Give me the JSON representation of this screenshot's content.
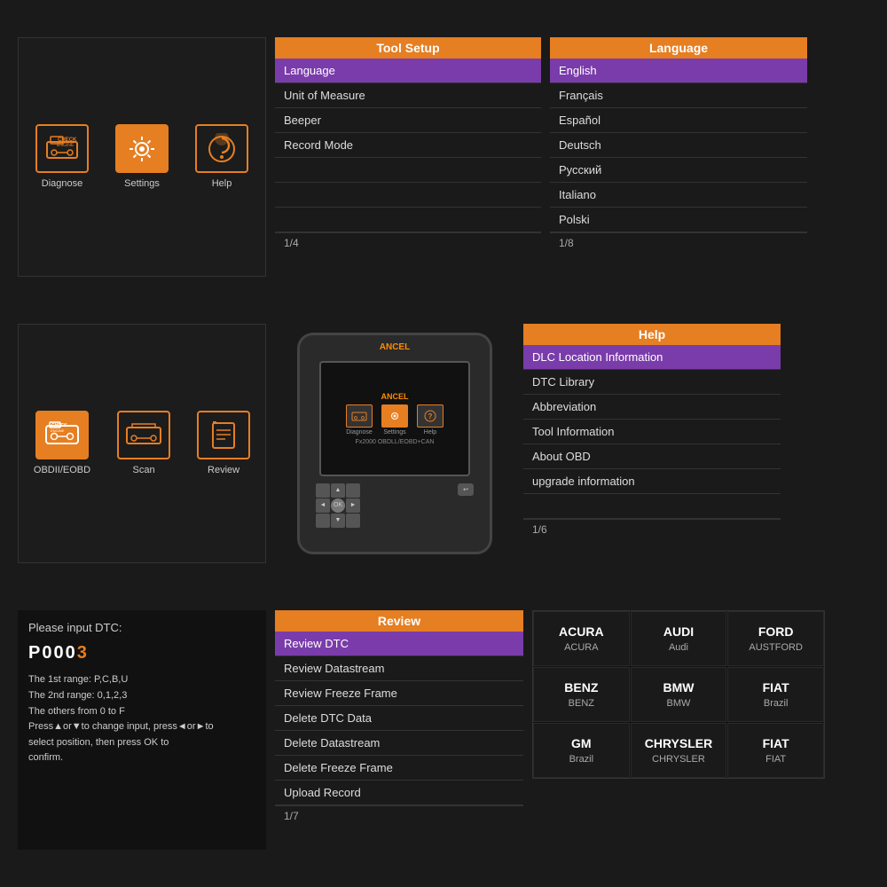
{
  "row1": {
    "main_menu": {
      "items": [
        {
          "id": "diagnose",
          "label": "Diagnose",
          "active": false
        },
        {
          "id": "settings",
          "label": "Settings",
          "active": true
        },
        {
          "id": "help",
          "label": "Help",
          "active": false
        }
      ]
    },
    "tool_setup": {
      "header": "Tool Setup",
      "items": [
        "Language",
        "Unit of Measure",
        "Beeper",
        "Record Mode"
      ],
      "active_index": 0,
      "empty_rows": 3,
      "footer": "1/4"
    },
    "language": {
      "header": "Language",
      "items": [
        "English",
        "Français",
        "Español",
        "Deutsch",
        "Русский",
        "Italiano",
        "Polski"
      ],
      "active_index": 0,
      "footer": "1/8"
    }
  },
  "row2": {
    "diagnose_menu": {
      "items": [
        {
          "id": "obdii",
          "label": "OBDII/EOBD",
          "active": true
        },
        {
          "id": "scan",
          "label": "Scan",
          "active": false
        },
        {
          "id": "review",
          "label": "Review",
          "active": false
        }
      ]
    },
    "device": {
      "brand": "ANCEL",
      "model": "Fx2000 OBDLL/EOBD+CAN",
      "screen_title": "ANCEL",
      "icons": [
        "Diagnose",
        "Settings",
        "Help"
      ]
    },
    "help": {
      "header": "Help",
      "items": [
        "DLC Location Information",
        "DTC Library",
        "Abbreviation",
        "Tool Information",
        "About OBD",
        "upgrade information"
      ],
      "active_index": 0,
      "footer": "1/6"
    }
  },
  "row3": {
    "dtc_input": {
      "title": "Please input DTC:",
      "code_prefix": "P000",
      "code_highlight": "3",
      "description": "The 1st range: P,C,B,U\nThe 2nd range: 0,1,2,3\nThe others from 0 to F\nPress▲or▼to change input, press◄or►to\nselect position, then press OK to\nconfirm."
    },
    "review": {
      "header": "Review",
      "items": [
        "Review DTC",
        "Review Datastream",
        "Review Freeze Frame",
        "Delete DTC Data",
        "Delete Datastream",
        "Delete Freeze Frame",
        "Upload Record"
      ],
      "active_index": 0,
      "footer": "1/7"
    },
    "brands": [
      {
        "large": "ACURA",
        "small": "ACURA"
      },
      {
        "large": "AUDI",
        "small": "Audi"
      },
      {
        "large": "FORD",
        "small": "AUSTFORD"
      },
      {
        "large": "BENZ",
        "small": "BENZ"
      },
      {
        "large": "BMW",
        "small": "BMW"
      },
      {
        "large": "FIAT",
        "small": "Brazil"
      },
      {
        "large": "GM",
        "small": "Brazil"
      },
      {
        "large": "CHRYSLER",
        "small": "CHRYSLER"
      },
      {
        "large": "FIAT",
        "small": "FIAT"
      }
    ]
  },
  "icons": {
    "diagnose": "🚗",
    "settings": "⚙️",
    "help": "🆘",
    "obdii": "🔧",
    "scan": "🚘",
    "review": "📋"
  }
}
